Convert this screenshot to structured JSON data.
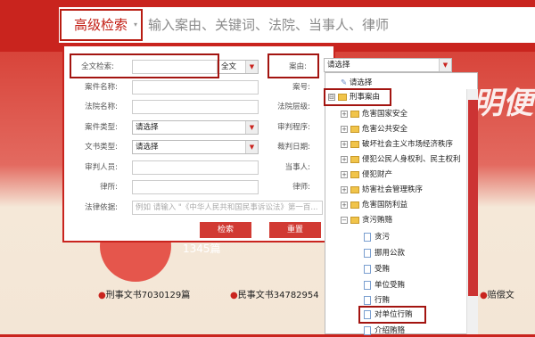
{
  "search": {
    "advanced_label": "高级检索",
    "caret": "▾",
    "placeholder": "输入案由、关键词、法院、当事人、律师"
  },
  "background": {
    "slogan_fragment": "明便",
    "count_text": "1345篇"
  },
  "form": {
    "fulltext_label": "全文检索:",
    "fulltext_scope": "全文",
    "case_name_label": "案件名称:",
    "court_name_label": "法院名称:",
    "case_type_label": "案件类型:",
    "case_type_value": "请选择",
    "doc_type_label": "文书类型:",
    "doc_type_value": "请选择",
    "judge_label": "审判人员:",
    "lawyer_firm_label": "律所:",
    "legal_basis_label": "法律依据:",
    "legal_basis_placeholder": "例如  请输入 \"《中华人民共和国民事诉讼法》第一百...",
    "cause_label": "案由:",
    "cause_value": "请选择",
    "case_no_label": "案号:",
    "court_level_label": "法院层级:",
    "trial_proc_label": "审判程序:",
    "judge_date_label": "裁判日期:",
    "party_label": "当事人:",
    "lawyer_label": "律师:",
    "search_button": "检索",
    "reset_button": "重置"
  },
  "tree": {
    "root": "请选择",
    "items": [
      {
        "label": "刑事案由",
        "kind": "folder",
        "toggle": "⊟"
      },
      {
        "label": "危害国家安全",
        "kind": "folder",
        "toggle": "+"
      },
      {
        "label": "危害公共安全",
        "kind": "folder",
        "toggle": "+"
      },
      {
        "label": "破坏社会主义市场经济秩序",
        "kind": "folder",
        "toggle": "+"
      },
      {
        "label": "侵犯公民人身权利、民主权利",
        "kind": "folder",
        "toggle": "+"
      },
      {
        "label": "侵犯财产",
        "kind": "folder",
        "toggle": "+"
      },
      {
        "label": "妨害社会管理秩序",
        "kind": "folder",
        "toggle": "+"
      },
      {
        "label": "危害国防利益",
        "kind": "folder",
        "toggle": "+"
      },
      {
        "label": "贪污贿赂",
        "kind": "folder",
        "toggle": "−"
      },
      {
        "label": "贪污",
        "kind": "doc"
      },
      {
        "label": "挪用公款",
        "kind": "doc"
      },
      {
        "label": "受贿",
        "kind": "doc"
      },
      {
        "label": "单位受贿",
        "kind": "doc"
      },
      {
        "label": "行贿",
        "kind": "doc"
      },
      {
        "label": "对单位行贿",
        "kind": "doc"
      },
      {
        "label": "介绍贿赂",
        "kind": "doc"
      }
    ]
  },
  "stats": {
    "criminal": "刑事文书7030129篇",
    "civil": "民事文书34782954",
    "compensation": "赔偿文"
  }
}
